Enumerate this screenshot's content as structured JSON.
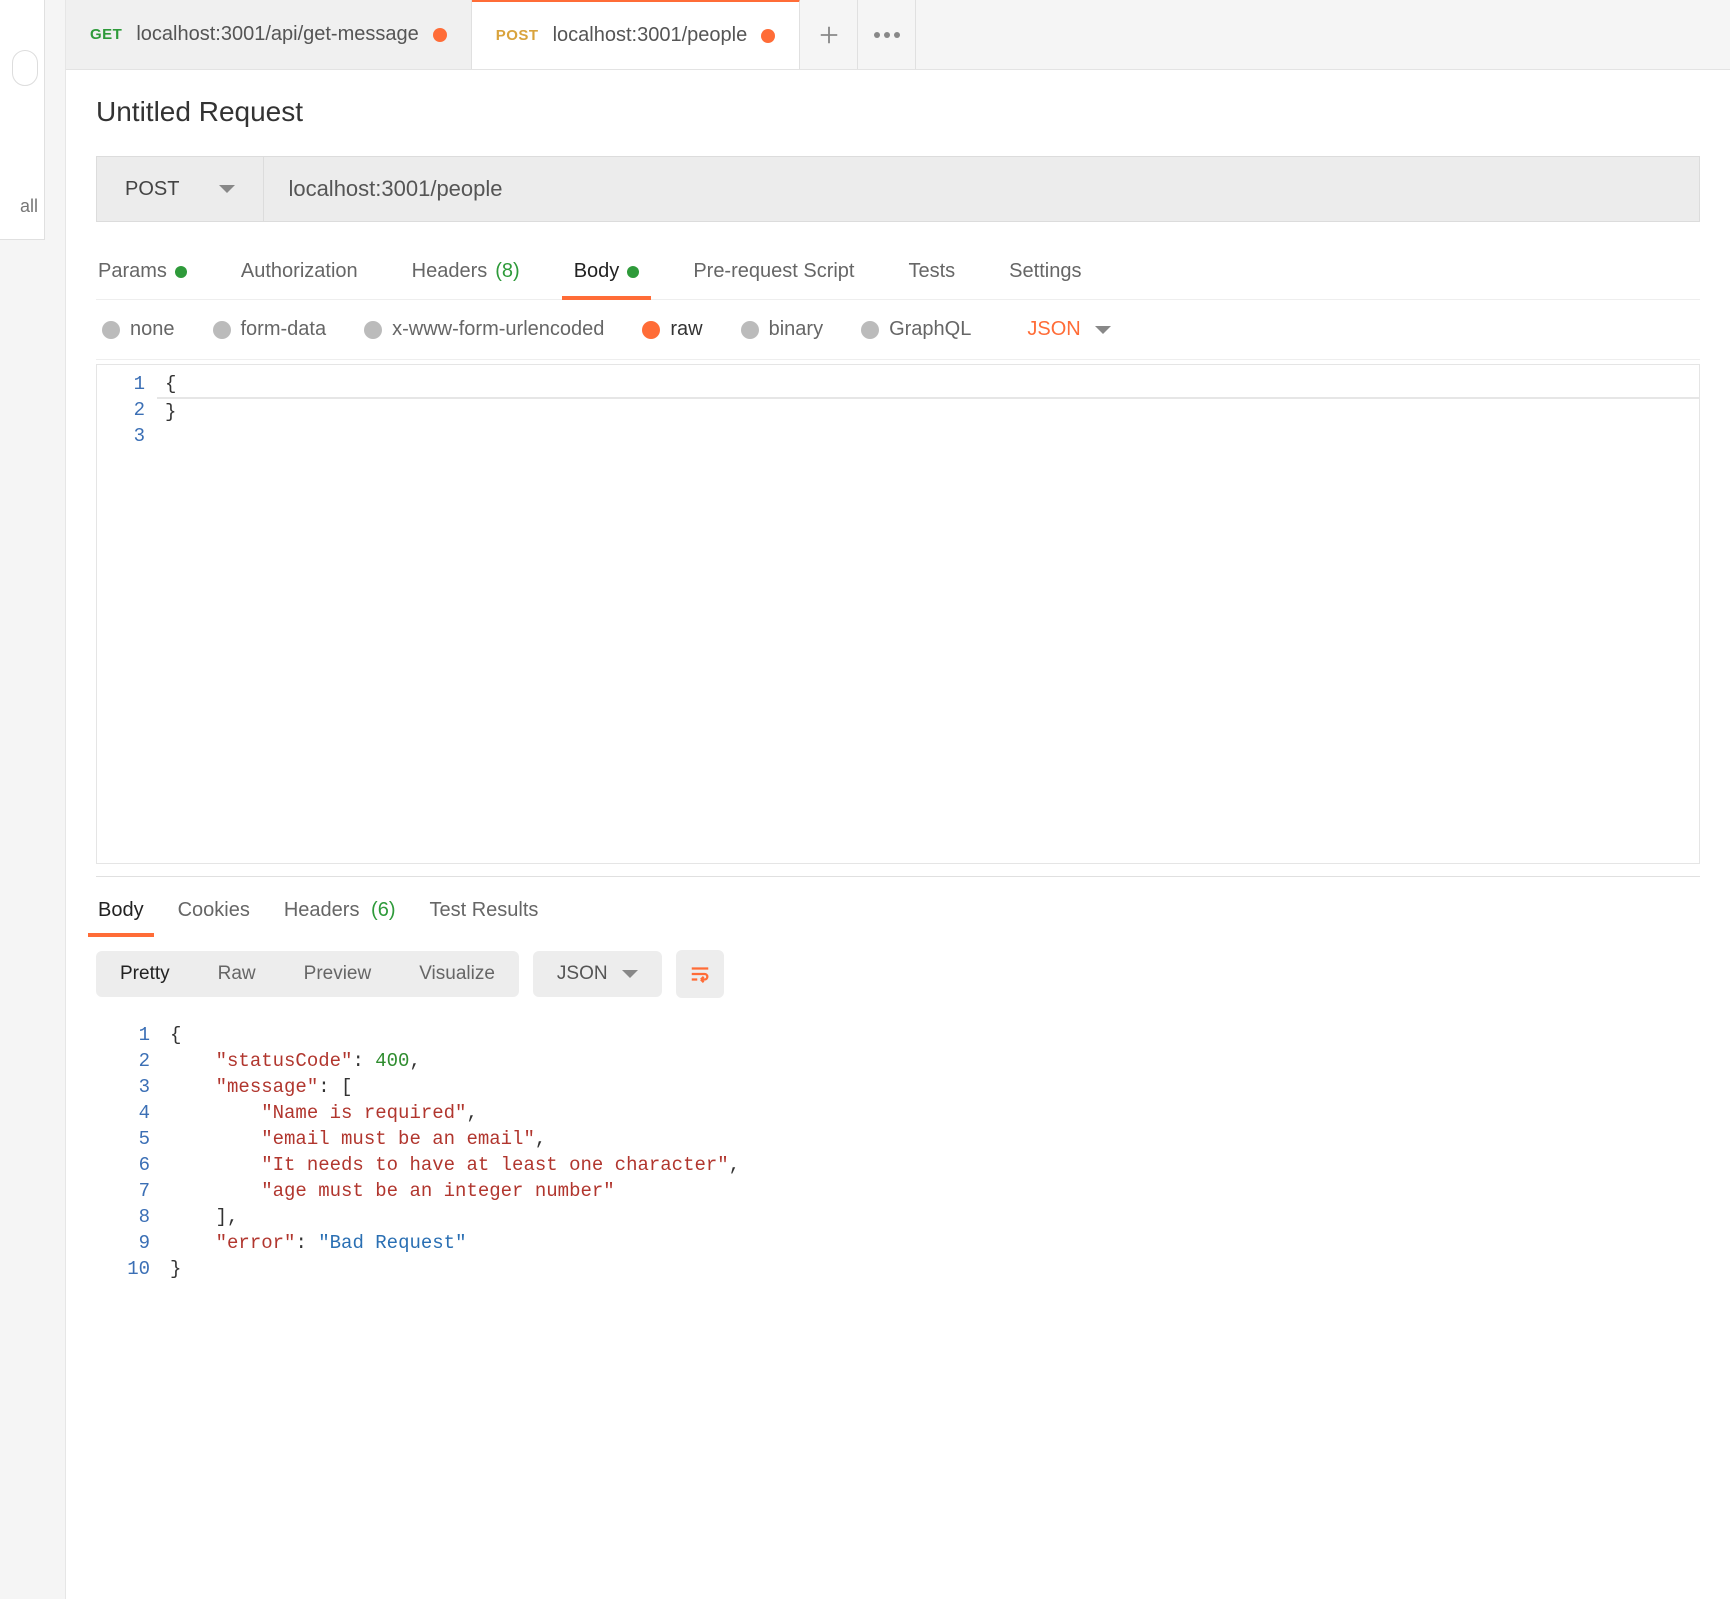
{
  "sidebar": {
    "all_label": "all"
  },
  "tabs": [
    {
      "method": "GET",
      "methodClass": "get",
      "url": "localhost:3001/api/get-message",
      "dirty": true,
      "active": false
    },
    {
      "method": "POST",
      "methodClass": "post",
      "url": "localhost:3001/people",
      "dirty": true,
      "active": true
    }
  ],
  "request": {
    "title": "Untitled Request",
    "method": "POST",
    "url": "localhost:3001/people",
    "subtabs": {
      "params": "Params",
      "authorization": "Authorization",
      "headers_label": "Headers",
      "headers_count": "(8)",
      "body": "Body",
      "prerequest": "Pre-request Script",
      "tests": "Tests",
      "settings": "Settings"
    },
    "body_types": {
      "none": "none",
      "form_data": "form-data",
      "urlencoded": "x-www-form-urlencoded",
      "raw": "raw",
      "binary": "binary",
      "graphql": "GraphQL",
      "lang": "JSON"
    },
    "body_lines": [
      "{",
      "",
      "}"
    ]
  },
  "response": {
    "tabs": {
      "body": "Body",
      "cookies": "Cookies",
      "headers_label": "Headers",
      "headers_count": "(6)",
      "test_results": "Test Results"
    },
    "views": {
      "pretty": "Pretty",
      "raw": "Raw",
      "preview": "Preview",
      "visualize": "Visualize",
      "format": "JSON"
    },
    "json": {
      "statusCode": 400,
      "message": [
        "Name is required",
        "email must be an email",
        "It needs to have at least one character",
        "age must be an integer number"
      ],
      "error": "Bad Request"
    }
  }
}
